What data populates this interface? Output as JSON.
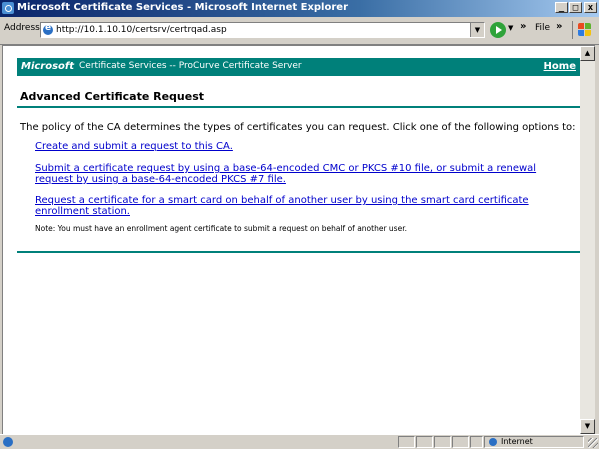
{
  "window": {
    "title": "Microsoft Certificate Services - Microsoft Internet Explorer",
    "minimize_label": "_",
    "maximize_label": "□",
    "close_label": "x"
  },
  "addressbar": {
    "label": "Address",
    "url": "http://10.1.10.10/certsrv/certrqad.asp",
    "file_menu": "File",
    "chevron": "»"
  },
  "banner": {
    "brand": "Microsoft",
    "service": "Certificate Services  --  ProCurve Certificate Server",
    "home": "Home"
  },
  "page": {
    "title": "Advanced Certificate Request",
    "intro": "The policy of the CA determines the types of certificates you can request. Click one of the following options to:",
    "options": [
      "Create and submit a request to this CA.",
      "Submit a certificate request by using a base-64-encoded CMC or PKCS #10 file, or submit a renewal request by using a base-64-encoded PKCS #7 file.",
      "Request a certificate for a smart card on behalf of another user by using the smart card certificate enrollment station."
    ],
    "note": "Note: You must have an enrollment agent certificate to submit a request on behalf of another user."
  },
  "status": {
    "zone": "Internet"
  },
  "colors": {
    "accent": "#00807a",
    "link": "#0000cc",
    "titlebar": "#0a246a"
  }
}
